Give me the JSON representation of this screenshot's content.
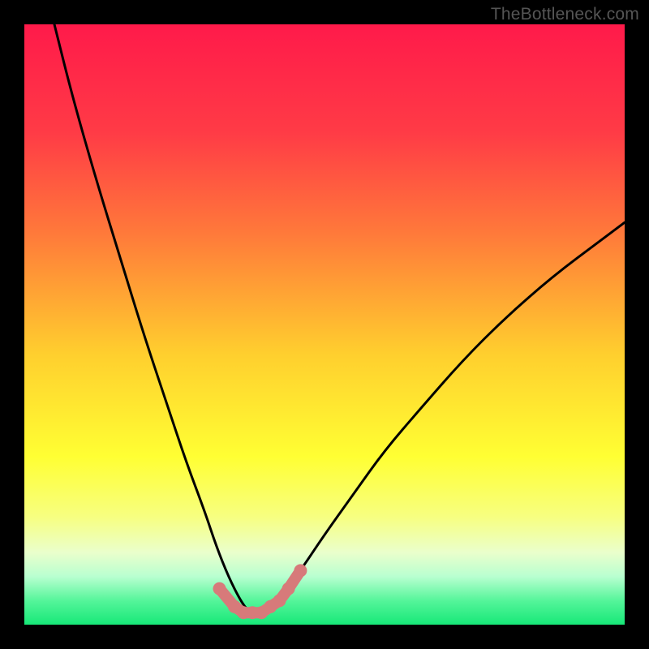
{
  "watermark": "TheBottleneck.com",
  "chart_data": {
    "type": "line",
    "title": "",
    "xlabel": "",
    "ylabel": "",
    "xlim": [
      0,
      100
    ],
    "ylim": [
      0,
      100
    ],
    "series": [
      {
        "name": "bottleneck-curve",
        "x": [
          5,
          8,
          12,
          16,
          20,
          24,
          27,
          30,
          32,
          34,
          36,
          37.5,
          39,
          41,
          43,
          46,
          50,
          55,
          60,
          66,
          73,
          80,
          88,
          96,
          100
        ],
        "y": [
          100,
          88,
          74,
          61,
          48,
          36,
          27,
          19,
          13,
          8,
          4,
          2,
          2,
          3,
          5,
          9,
          15,
          22,
          29,
          36,
          44,
          51,
          58,
          64,
          67
        ]
      }
    ],
    "markers": {
      "name": "highlight-dots",
      "color": "#d77a7a",
      "x": [
        32.5,
        35,
        36.5,
        38,
        39.5,
        41,
        42.5,
        44,
        46
      ],
      "y": [
        6,
        3,
        2,
        2,
        2,
        3,
        4,
        6,
        9
      ]
    },
    "gradient_stops": [
      {
        "t": 0.0,
        "color": "#ff1a4a"
      },
      {
        "t": 0.18,
        "color": "#ff3b46"
      },
      {
        "t": 0.35,
        "color": "#ff7a3a"
      },
      {
        "t": 0.55,
        "color": "#ffcf2e"
      },
      {
        "t": 0.72,
        "color": "#ffff33"
      },
      {
        "t": 0.82,
        "color": "#f7ff80"
      },
      {
        "t": 0.88,
        "color": "#eaffcc"
      },
      {
        "t": 0.92,
        "color": "#b8ffd0"
      },
      {
        "t": 0.96,
        "color": "#55f59a"
      },
      {
        "t": 1.0,
        "color": "#17e878"
      }
    ]
  }
}
